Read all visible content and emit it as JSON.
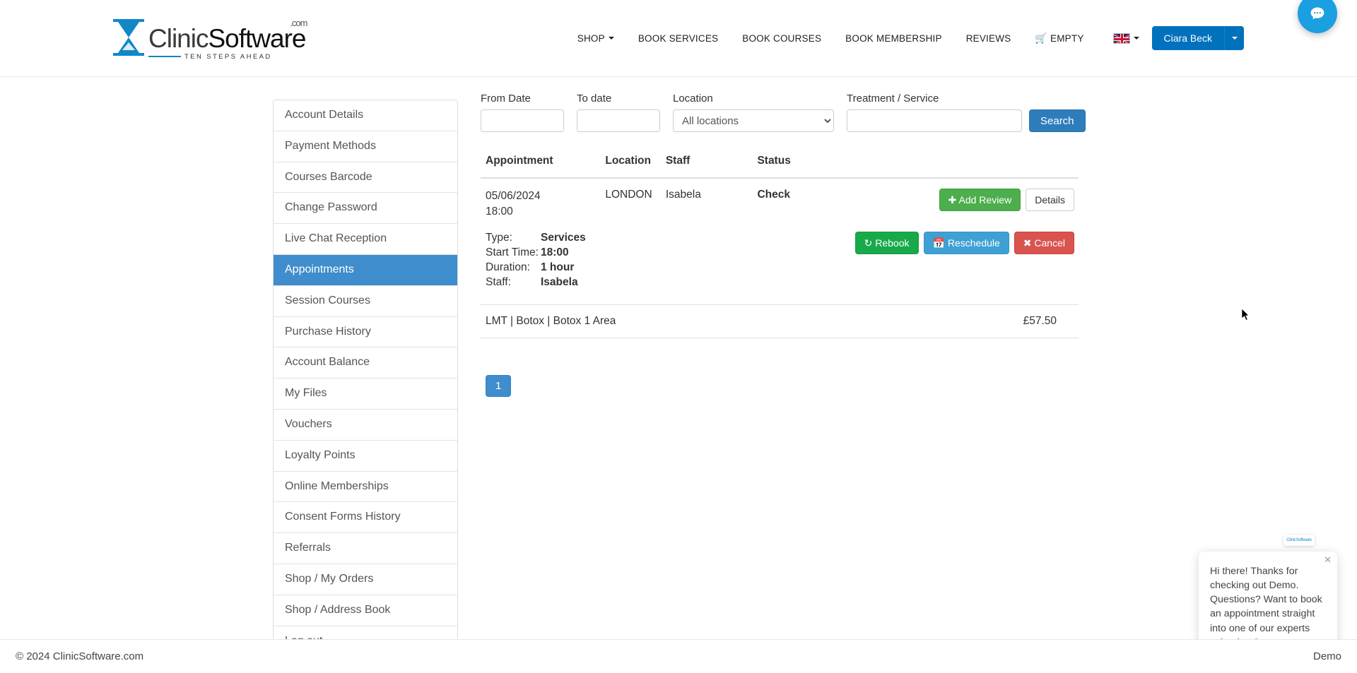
{
  "brand": {
    "name_part1": "Clinic",
    "name_part2": "Software",
    "dotcom": ".com",
    "tagline": "TEN STEPS AHEAD",
    "accent_color": "#1287c8"
  },
  "nav": {
    "items": [
      {
        "label": "SHOP",
        "has_caret": true
      },
      {
        "label": "BOOK SERVICES",
        "has_caret": false
      },
      {
        "label": "BOOK COURSES",
        "has_caret": false
      },
      {
        "label": "BOOK MEMBERSHIP",
        "has_caret": false
      },
      {
        "label": "REVIEWS",
        "has_caret": false
      }
    ],
    "cart_label": "EMPTY",
    "cart_icon": "cart-icon",
    "flag_icon": "uk-flag-icon",
    "user_name": "Ciara Beck"
  },
  "sidebar": {
    "items": [
      {
        "label": "Account Details",
        "active": false
      },
      {
        "label": "Payment Methods",
        "active": false
      },
      {
        "label": "Courses Barcode",
        "active": false
      },
      {
        "label": "Change Password",
        "active": false
      },
      {
        "label": "Live Chat Reception",
        "active": false
      },
      {
        "label": "Appointments",
        "active": true
      },
      {
        "label": "Session Courses",
        "active": false
      },
      {
        "label": "Purchase History",
        "active": false
      },
      {
        "label": "Account Balance",
        "active": false
      },
      {
        "label": "My Files",
        "active": false
      },
      {
        "label": "Vouchers",
        "active": false
      },
      {
        "label": "Loyalty Points",
        "active": false
      },
      {
        "label": "Online Memberships",
        "active": false
      },
      {
        "label": "Consent Forms History",
        "active": false
      },
      {
        "label": "Referrals",
        "active": false
      },
      {
        "label": "Shop / My Orders",
        "active": false
      },
      {
        "label": "Shop / Address Book",
        "active": false
      },
      {
        "label": "Log out",
        "active": false
      }
    ]
  },
  "filters": {
    "from_date_label": "From Date",
    "from_date_value": "",
    "to_date_label": "To date",
    "to_date_value": "",
    "location_label": "Location",
    "location_selected": "All locations",
    "location_options": [
      "All locations"
    ],
    "treatment_label": "Treatment / Service",
    "treatment_value": "",
    "search_button": "Search"
  },
  "table": {
    "headers": {
      "appointment": "Appointment",
      "location": "Location",
      "staff": "Staff",
      "status": "Status"
    },
    "row": {
      "date": "05/06/2024",
      "time": "18:00",
      "location": "LONDON",
      "staff": "Isabela",
      "status": "Check",
      "add_review_button": "Add Review",
      "add_review_icon": "plus-icon",
      "details_button": "Details"
    },
    "details": {
      "type_label": "Type:",
      "type_value": "Services",
      "start_time_label": "Start Time:",
      "start_time_value": "18:00",
      "duration_label": "Duration:",
      "duration_value": "1 hour",
      "staff_label": "Staff:",
      "staff_value": "Isabela",
      "rebook_button": "Rebook",
      "rebook_icon": "refresh-icon",
      "reschedule_button": "Reschedule",
      "reschedule_icon": "calendar-icon",
      "cancel_button": "Cancel",
      "cancel_icon": "x-icon"
    },
    "service_line": {
      "name": "LMT | Botox | Botox 1 Area",
      "price": "£57.50"
    }
  },
  "pagination": {
    "current_page": "1"
  },
  "chat": {
    "logo_text": "ClinicSoftware",
    "message": "Hi there! Thanks for checking out Demo. Questions? Want to book an appointment straight into one of our experts calendars?",
    "close_icon": "close-icon",
    "fab_icon": "chat-icon",
    "fab_color": "#1a9fe0"
  },
  "footer": {
    "copyright": "© 2024 ClinicSoftware.com",
    "demo_label": "Demo"
  }
}
